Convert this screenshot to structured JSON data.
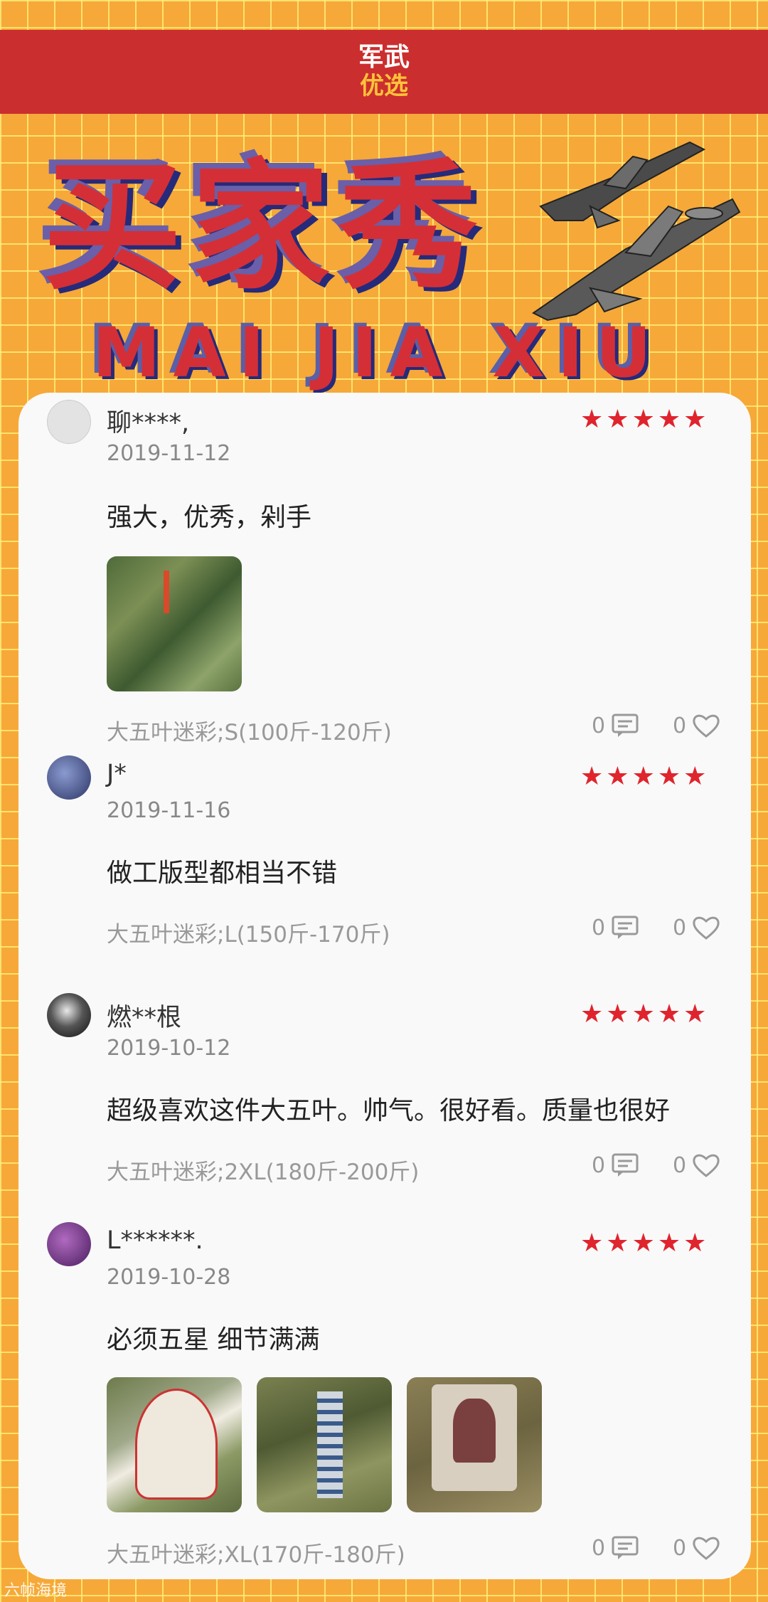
{
  "brand": {
    "logo_top": "军武",
    "logo_bottom": "优选"
  },
  "title": {
    "cn": "买家秀",
    "en": "MAI JIA XIU"
  },
  "reviews": [
    {
      "user": "聊****,",
      "date": "2019-11-12",
      "rating": 5,
      "content": "强大，优秀，剁手",
      "spec": "大五叶迷彩;S(100斤-120斤)",
      "comments": "0",
      "likes": "0",
      "avatar_color": "#d8d8d8",
      "photos": 1
    },
    {
      "user": "J*",
      "date": "2019-11-16",
      "rating": 5,
      "content": "做工版型都相当不错",
      "spec": "大五叶迷彩;L(150斤-170斤)",
      "comments": "0",
      "likes": "0",
      "avatar_color": "#3b4a78",
      "photos": 0
    },
    {
      "user": "燃**根",
      "date": "2019-10-12",
      "rating": 5,
      "content": "超级喜欢这件大五叶。帅气。很好看。质量也很好",
      "spec": "大五叶迷彩;2XL(180斤-200斤)",
      "comments": "0",
      "likes": "0",
      "avatar_color": "#2b2b2b",
      "photos": 0
    },
    {
      "user": "L******.",
      "date": "2019-10-28",
      "rating": 5,
      "content": "必须五星 细节满满",
      "spec": "大五叶迷彩;XL(170斤-180斤)",
      "comments": "0",
      "likes": "0",
      "avatar_color": "#6a2f7a",
      "photos": 3
    }
  ],
  "icons": {
    "star": "star-icon",
    "comment": "comment-icon",
    "like": "heart-icon"
  },
  "watermark": "六帧海境",
  "colors": {
    "header_red": "#cb2e2e",
    "star_red": "#e0242d",
    "background": "#f6a938"
  }
}
